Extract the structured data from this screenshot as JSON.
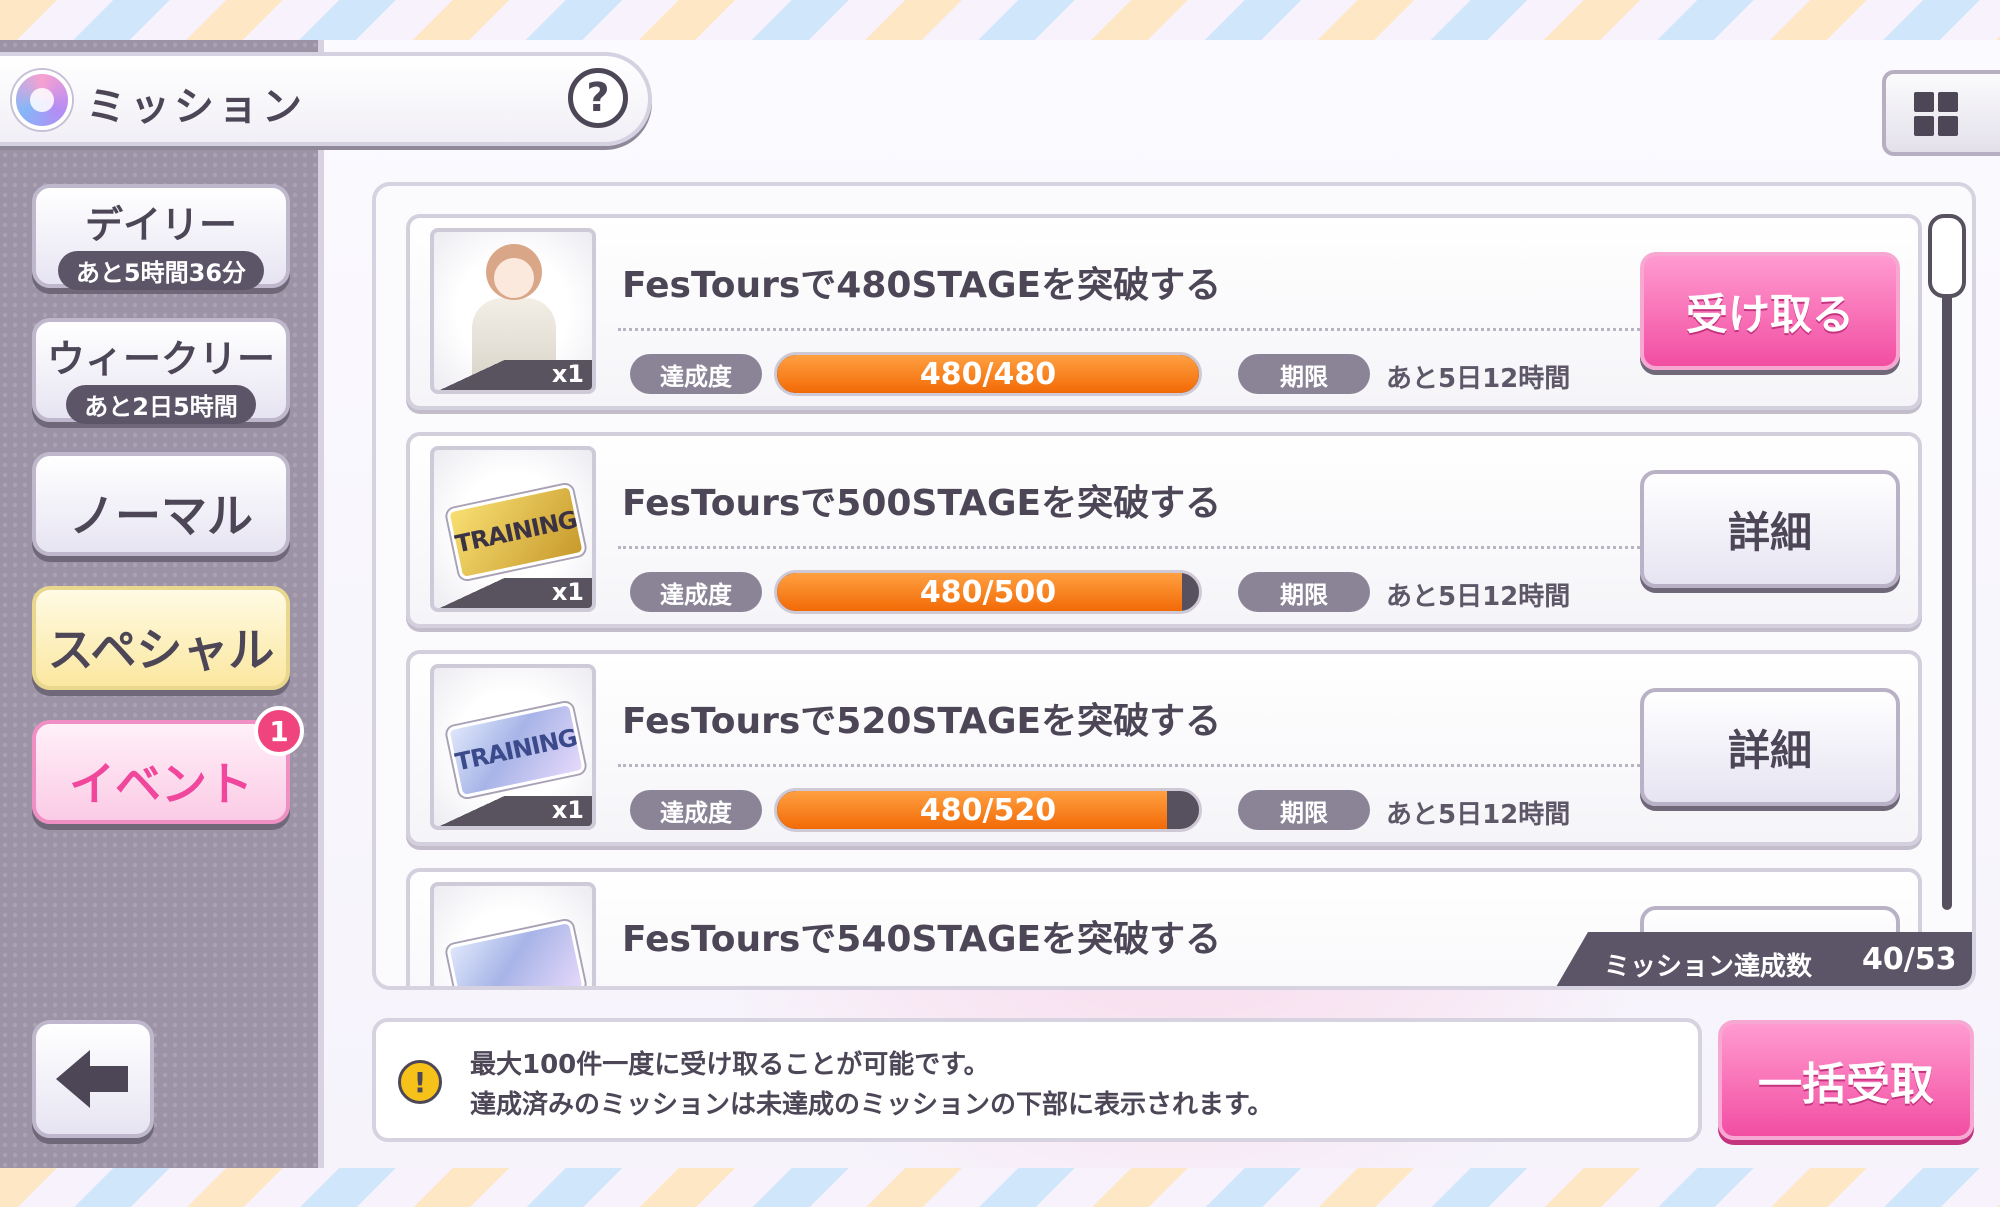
{
  "header": {
    "title": "ミッション",
    "help_label": "?"
  },
  "categories": [
    {
      "label": "デイリー",
      "sub": "あと5時間36分"
    },
    {
      "label": "ウィークリー",
      "sub": "あと2日5時間"
    },
    {
      "label": "ノーマル"
    },
    {
      "label": "スペシャル"
    },
    {
      "label": "イベント",
      "badge": "1"
    }
  ],
  "missions": [
    {
      "title": "FesToursで480STAGEを突破する",
      "progress_label": "達成度",
      "progress_text": "480/480",
      "progress": 1.0,
      "deadline_label": "期限",
      "deadline": "あと5日12時間",
      "reward_count": "x1",
      "reward_icon": "character-costume-icon",
      "action": "受け取る"
    },
    {
      "title": "FesToursで500STAGEを突破する",
      "progress_label": "達成度",
      "progress_text": "480/500",
      "progress": 0.96,
      "deadline_label": "期限",
      "deadline": "あと5日12時間",
      "reward_count": "x1",
      "reward_icon": "gold-training-ticket-icon",
      "reward_ticket_text": "TRAINING",
      "action": "詳細"
    },
    {
      "title": "FesToursで520STAGEを突破する",
      "progress_label": "達成度",
      "progress_text": "480/520",
      "progress": 0.923,
      "deadline_label": "期限",
      "deadline": "あと5日12時間",
      "reward_count": "x1",
      "reward_icon": "platinum-training-ticket-icon",
      "reward_ticket_text": "TRAINING",
      "action": "詳細"
    },
    {
      "title": "FesToursで540STAGEを突破する",
      "reward_icon": "platinum-training-ticket-icon"
    }
  ],
  "achievement": {
    "label": "ミッション達成数",
    "value": "40/53"
  },
  "notice": {
    "line1": "最大100件一度に受け取ることが可能です。",
    "line2": "達成済みのミッションは未達成のミッションの下部に表示されます。"
  },
  "bulk_button": "一括受取",
  "colors": {
    "accent_pink": "#f24ea2",
    "progress_orange": "#f26a06",
    "text_dark": "#4c4657"
  }
}
